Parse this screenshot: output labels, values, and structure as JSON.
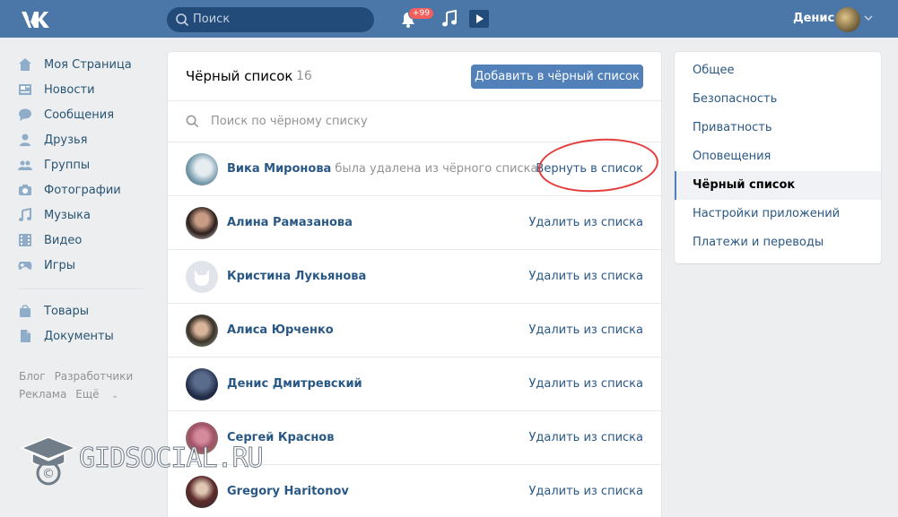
{
  "header": {
    "logo_icon": "vk-logo-icon",
    "search_placeholder": "Поиск",
    "notifications_badge": "+99",
    "user_name": "Денис"
  },
  "left_nav": {
    "items": [
      {
        "label": "Моя Страница",
        "icon": "home-icon"
      },
      {
        "label": "Новости",
        "icon": "news-icon"
      },
      {
        "label": "Сообщения",
        "icon": "messages-icon"
      },
      {
        "label": "Друзья",
        "icon": "friends-icon"
      },
      {
        "label": "Группы",
        "icon": "groups-icon"
      },
      {
        "label": "Фотографии",
        "icon": "camera-icon"
      },
      {
        "label": "Музыка",
        "icon": "music-icon"
      },
      {
        "label": "Видео",
        "icon": "video-icon"
      },
      {
        "label": "Игры",
        "icon": "gamepad-icon"
      }
    ],
    "items2": [
      {
        "label": "Товары",
        "icon": "bag-icon"
      },
      {
        "label": "Документы",
        "icon": "document-icon"
      }
    ],
    "footer": {
      "blog": "Блог",
      "developers": "Разработчики",
      "ads": "Реклама",
      "more": "Ещё"
    }
  },
  "main": {
    "title": "Чёрный список",
    "count": "16",
    "add_button": "Добавить в чёрный список",
    "search_placeholder": "Поиск по чёрному списку",
    "rows": [
      {
        "name": "Вика Миронова",
        "status": "была удалена из чёрного списка",
        "action": "Вернуть в список"
      },
      {
        "name": "Алина Рамазанова",
        "status": "",
        "action": "Удалить из списка"
      },
      {
        "name": "Кристина Лукьянова",
        "status": "",
        "action": "Удалить из списка"
      },
      {
        "name": "Алиса Юрченко",
        "status": "",
        "action": "Удалить из списка"
      },
      {
        "name": "Денис Дмитревский",
        "status": "",
        "action": "Удалить из списка"
      },
      {
        "name": "Сергей Краснов",
        "status": "",
        "action": "Удалить из списка"
      },
      {
        "name": "Gregory Haritonov",
        "status": "",
        "action": "Удалить из списка"
      }
    ]
  },
  "right_nav": {
    "items": [
      "Общее",
      "Безопасность",
      "Приватность",
      "Оповещения",
      "Чёрный список",
      "Настройки приложений",
      "Платежи и переводы"
    ],
    "selected": "Чёрный список"
  },
  "watermark": "GIDSOCIAL.RU",
  "colors": {
    "header": "#4a76a8",
    "link": "#2a5885",
    "button": "#5181b8",
    "highlight": "#e53c3c"
  }
}
